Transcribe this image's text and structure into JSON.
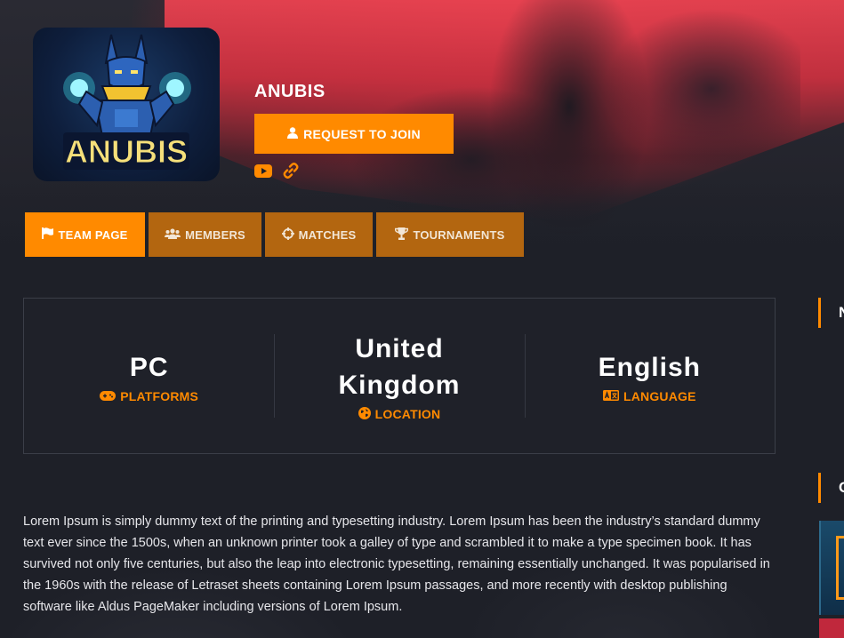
{
  "team": {
    "name": "ANUBIS",
    "logo_text": "ANUBIS",
    "join_label": "REQUEST TO JOIN",
    "icons": [
      "user-icon",
      "youtube-icon",
      "link-icon"
    ]
  },
  "tabs": [
    {
      "label": "TEAM PAGE",
      "icon": "flag-icon",
      "active": true
    },
    {
      "label": "MEMBERS",
      "icon": "users-icon",
      "active": false
    },
    {
      "label": "MATCHES",
      "icon": "crosshair-icon",
      "active": false
    },
    {
      "label": "TOURNAMENTS",
      "icon": "trophy-icon",
      "active": false
    }
  ],
  "stats": [
    {
      "value": "PC",
      "label": "PLATFORMS",
      "icon": "gamepad-icon"
    },
    {
      "value": "United Kingdom",
      "label": "LOCATION",
      "icon": "globe-icon"
    },
    {
      "value": "English",
      "label": "LANGUAGE",
      "icon": "language-icon"
    }
  ],
  "description": "Lorem Ipsum is simply dummy text of the printing and typesetting industry. Lorem Ipsum has been the industry’s standard dummy text ever since the 1500s, when an unknown printer took a galley of type and scrambled it to make a type specimen book. It has survived not only five centuries, but also the leap into electronic typesetting, remaining essentially unchanged. It was popularised in the 1960s with the release of Letraset sheets containing Lorem Ipsum passages, and more recently with desktop publishing software like Aldus PageMaker including versions of Lorem Ipsum.",
  "sidebar": {
    "heading1_initial": "N",
    "heading2_initial": "C"
  },
  "colors": {
    "accent": "#ff8a00",
    "tab_inactive": "#b36610",
    "background": "#1e2028",
    "hero_red": "#e84250"
  }
}
